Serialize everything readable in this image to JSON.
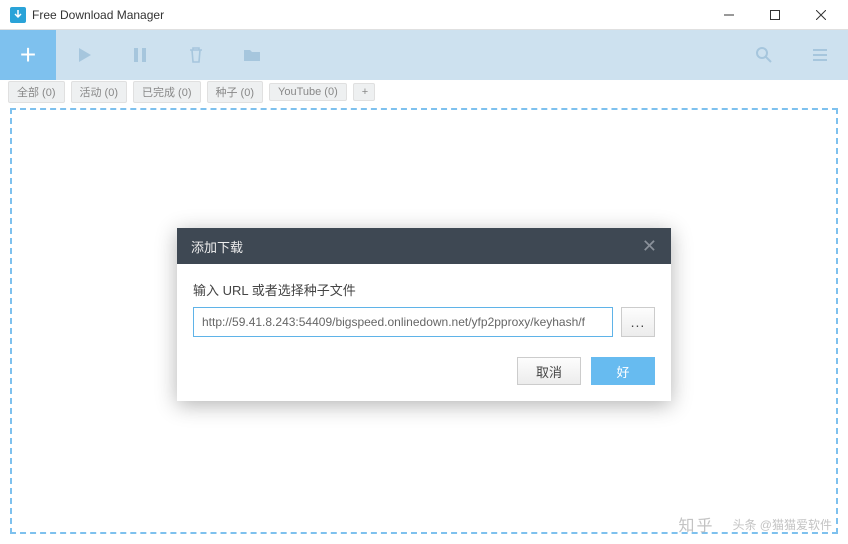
{
  "window": {
    "title": "Free Download Manager"
  },
  "toolbar": {
    "add": "+"
  },
  "tabs": {
    "items": [
      {
        "label": "全部 (0)"
      },
      {
        "label": "活动 (0)"
      },
      {
        "label": "已完成 (0)"
      },
      {
        "label": "种子 (0)"
      },
      {
        "label": "YouTube (0)"
      }
    ],
    "add": "+"
  },
  "dialog": {
    "title": "添加下载",
    "label": "输入 URL 或者选择种子文件",
    "url_value": "http://59.41.8.243:54409/bigspeed.onlinedown.net/yfp2pproxy/keyhash/f",
    "browse": "...",
    "cancel": "取消",
    "ok": "好"
  },
  "watermark": {
    "zhihu": "知乎",
    "toutiao": "头条 @猫猫爱软件"
  }
}
